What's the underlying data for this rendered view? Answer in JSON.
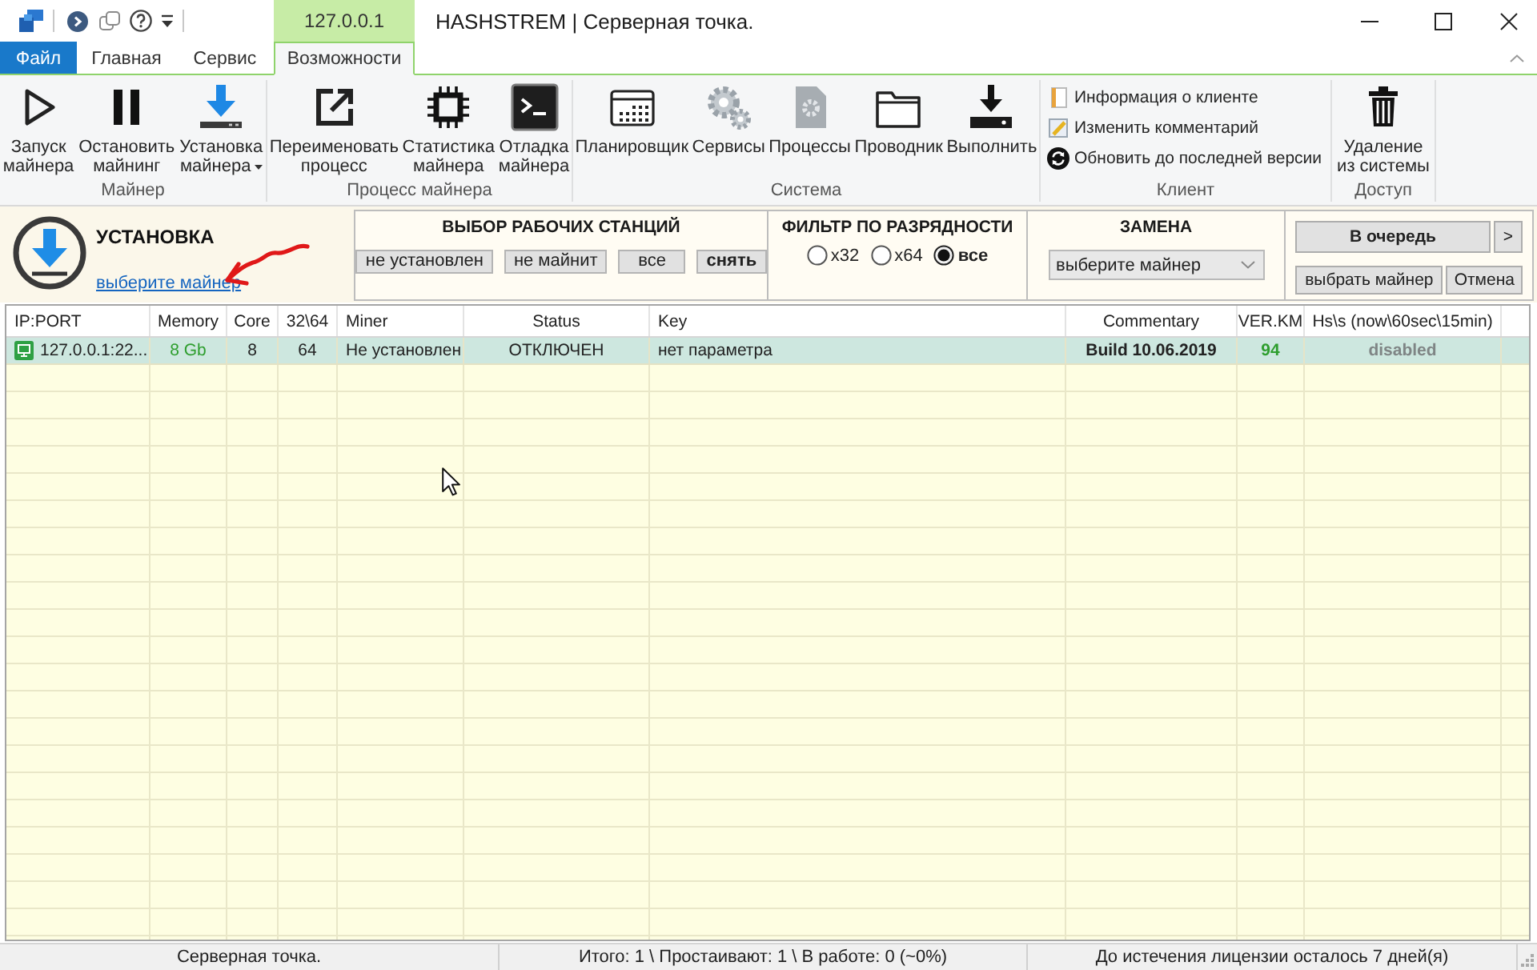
{
  "title_bar": {
    "context_tab": "127.0.0.1",
    "title": "HASHSTREM | Серверная точка."
  },
  "ribbon_tabs": [
    {
      "label": "Файл",
      "kind": "file",
      "selected": false
    },
    {
      "label": "Главная",
      "kind": "tab",
      "selected": false
    },
    {
      "label": "Сервис",
      "kind": "tab",
      "selected": false
    },
    {
      "label": "Возможности",
      "kind": "tab",
      "selected": true
    }
  ],
  "ribbon": {
    "groups": [
      {
        "label": "Майнер",
        "buttons": [
          {
            "kind": "large",
            "lines": [
              "Запуск",
              "майнера"
            ],
            "dropdown": false
          },
          {
            "kind": "large",
            "lines": [
              "Остановить",
              "майнинг"
            ],
            "dropdown": false
          },
          {
            "kind": "large",
            "lines": [
              "Установка",
              "майнера"
            ],
            "dropdown": true
          }
        ]
      },
      {
        "label": "Процесс майнера",
        "buttons": [
          {
            "kind": "large",
            "lines": [
              "Переименовать",
              "процесс"
            ],
            "dropdown": false
          },
          {
            "kind": "large",
            "lines": [
              "Статистика",
              "майнера"
            ],
            "dropdown": false
          },
          {
            "kind": "large",
            "lines": [
              "Отладка",
              "майнера"
            ],
            "dropdown": false
          }
        ]
      },
      {
        "label": "Система",
        "buttons": [
          {
            "kind": "large",
            "lines": [
              "Планировщик"
            ],
            "dropdown": false
          },
          {
            "kind": "large",
            "lines": [
              "Сервисы"
            ],
            "dropdown": false
          },
          {
            "kind": "large",
            "lines": [
              "Процессы"
            ],
            "dropdown": false
          },
          {
            "kind": "large",
            "lines": [
              "Проводник"
            ],
            "dropdown": false
          },
          {
            "kind": "large",
            "lines": [
              "Выполнить"
            ],
            "dropdown": false
          }
        ]
      },
      {
        "label": "Клиент",
        "buttons": [
          {
            "kind": "small",
            "lines": [
              "Информация о клиенте"
            ],
            "dropdown": false
          },
          {
            "kind": "small",
            "lines": [
              "Изменить комментарий"
            ],
            "dropdown": false
          },
          {
            "kind": "small",
            "lines": [
              "Обновить до последней версии"
            ],
            "dropdown": false
          }
        ]
      },
      {
        "label": "Доступ",
        "buttons": [
          {
            "kind": "large",
            "lines": [
              "Удаление",
              "из системы"
            ],
            "dropdown": false
          }
        ]
      }
    ]
  },
  "install_panel": {
    "title": "УСТАНОВКА",
    "link": "выберите майнер"
  },
  "workstations": {
    "title": "ВЫБОР РАБОЧИХ СТАНЦИЙ",
    "buttons": [
      {
        "label": "не установлен",
        "kind": "filter"
      },
      {
        "label": "не майнит",
        "kind": "filter"
      },
      {
        "label": "все",
        "kind": "filter"
      },
      {
        "label": "снять",
        "kind": "clear"
      }
    ]
  },
  "bitness_filter": {
    "title": "ФИЛЬТР ПО РАЗРЯДНОСТИ",
    "options": [
      {
        "label": "x32",
        "selected": false
      },
      {
        "label": "x64",
        "selected": false
      },
      {
        "label": "все",
        "selected": true
      }
    ]
  },
  "replacement": {
    "title": "ЗАМЕНА",
    "dropdown": {
      "value": "выберите майнер"
    }
  },
  "queue": {
    "rows": [
      [
        {
          "label": "В очередь",
          "kind": "primary"
        },
        {
          "label": ">",
          "kind": "arrow"
        }
      ],
      [
        {
          "label": "выбрать майнер",
          "kind": "plain"
        },
        {
          "label": "Отмена",
          "kind": "plain"
        }
      ]
    ]
  },
  "table": {
    "columns": [
      "IP:PORT",
      "Memory",
      "Core",
      "32\\64",
      "Miner",
      "Status",
      "Key",
      "Commentary",
      "VER.KM",
      "Hs\\s (now\\60sec\\15min)"
    ],
    "rows": [
      {
        "selected": true,
        "cells": [
          "127.0.0.1:22...",
          "8 Gb",
          "8",
          "64",
          "Не установлен",
          "ОТКЛЮЧЕН",
          "нет параметра",
          "Build 10.06.2019",
          "94",
          "disabled"
        ]
      }
    ]
  },
  "status_bar": [
    "Серверная точка.",
    "Итого: 1 \\ Простаивают: 1 \\ В работе: 0 (~0%)",
    "До истечения лицензии осталось 7 дней(я)"
  ]
}
